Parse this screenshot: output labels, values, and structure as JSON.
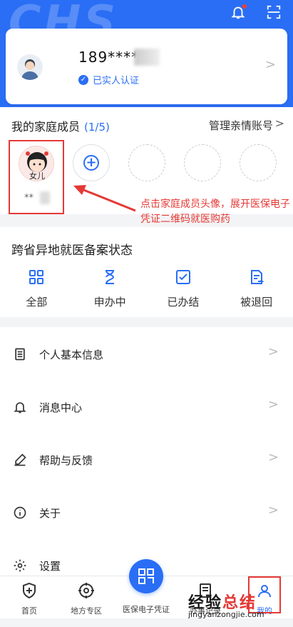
{
  "header": {
    "logo_text": "CHS",
    "icons": [
      "bell-icon",
      "scan-icon"
    ],
    "accent": "#2a6ef5"
  },
  "profile": {
    "phone": "189****",
    "verified_label": "已实人认证"
  },
  "family": {
    "title": "我的家庭成员",
    "count": "(1/5)",
    "manage_label": "管理亲情账号",
    "manage_chevron": ">",
    "members": [
      {
        "badge": "女儿",
        "name": "**"
      }
    ],
    "add_symbol": "+",
    "annotation": "点击家庭成员头像，展开医保电子凭证二维码就医购药"
  },
  "filing": {
    "title": "跨省异地就医备案状态",
    "items": [
      {
        "label": "全部",
        "icon": "grid-icon"
      },
      {
        "label": "申办中",
        "icon": "hourglass-icon"
      },
      {
        "label": "已办结",
        "icon": "checkbox-icon"
      },
      {
        "label": "被退回",
        "icon": "returned-doc-icon"
      }
    ]
  },
  "menu": {
    "items": [
      {
        "label": "个人基本信息",
        "icon": "document-icon"
      },
      {
        "label": "消息中心",
        "icon": "bell-icon"
      },
      {
        "label": "帮助与反馈",
        "icon": "pen-icon"
      },
      {
        "label": "关于",
        "icon": "info-icon"
      },
      {
        "label": "设置",
        "icon": "gear-icon"
      }
    ],
    "chevron": ">"
  },
  "tabbar": {
    "tabs": [
      {
        "label": "首页",
        "icon": "shield-plus-icon"
      },
      {
        "label": "地方专区",
        "icon": "location-target-icon"
      },
      {
        "label": "医保电子凭证",
        "icon": "qr-code-icon"
      },
      {
        "label": "办事记录",
        "icon": "record-icon"
      },
      {
        "label": "我的",
        "icon": "user-icon"
      }
    ]
  },
  "watermark": {
    "chars_black": "经验",
    "chars_red": "总结",
    "domain": "jingyanzongjie.com"
  }
}
